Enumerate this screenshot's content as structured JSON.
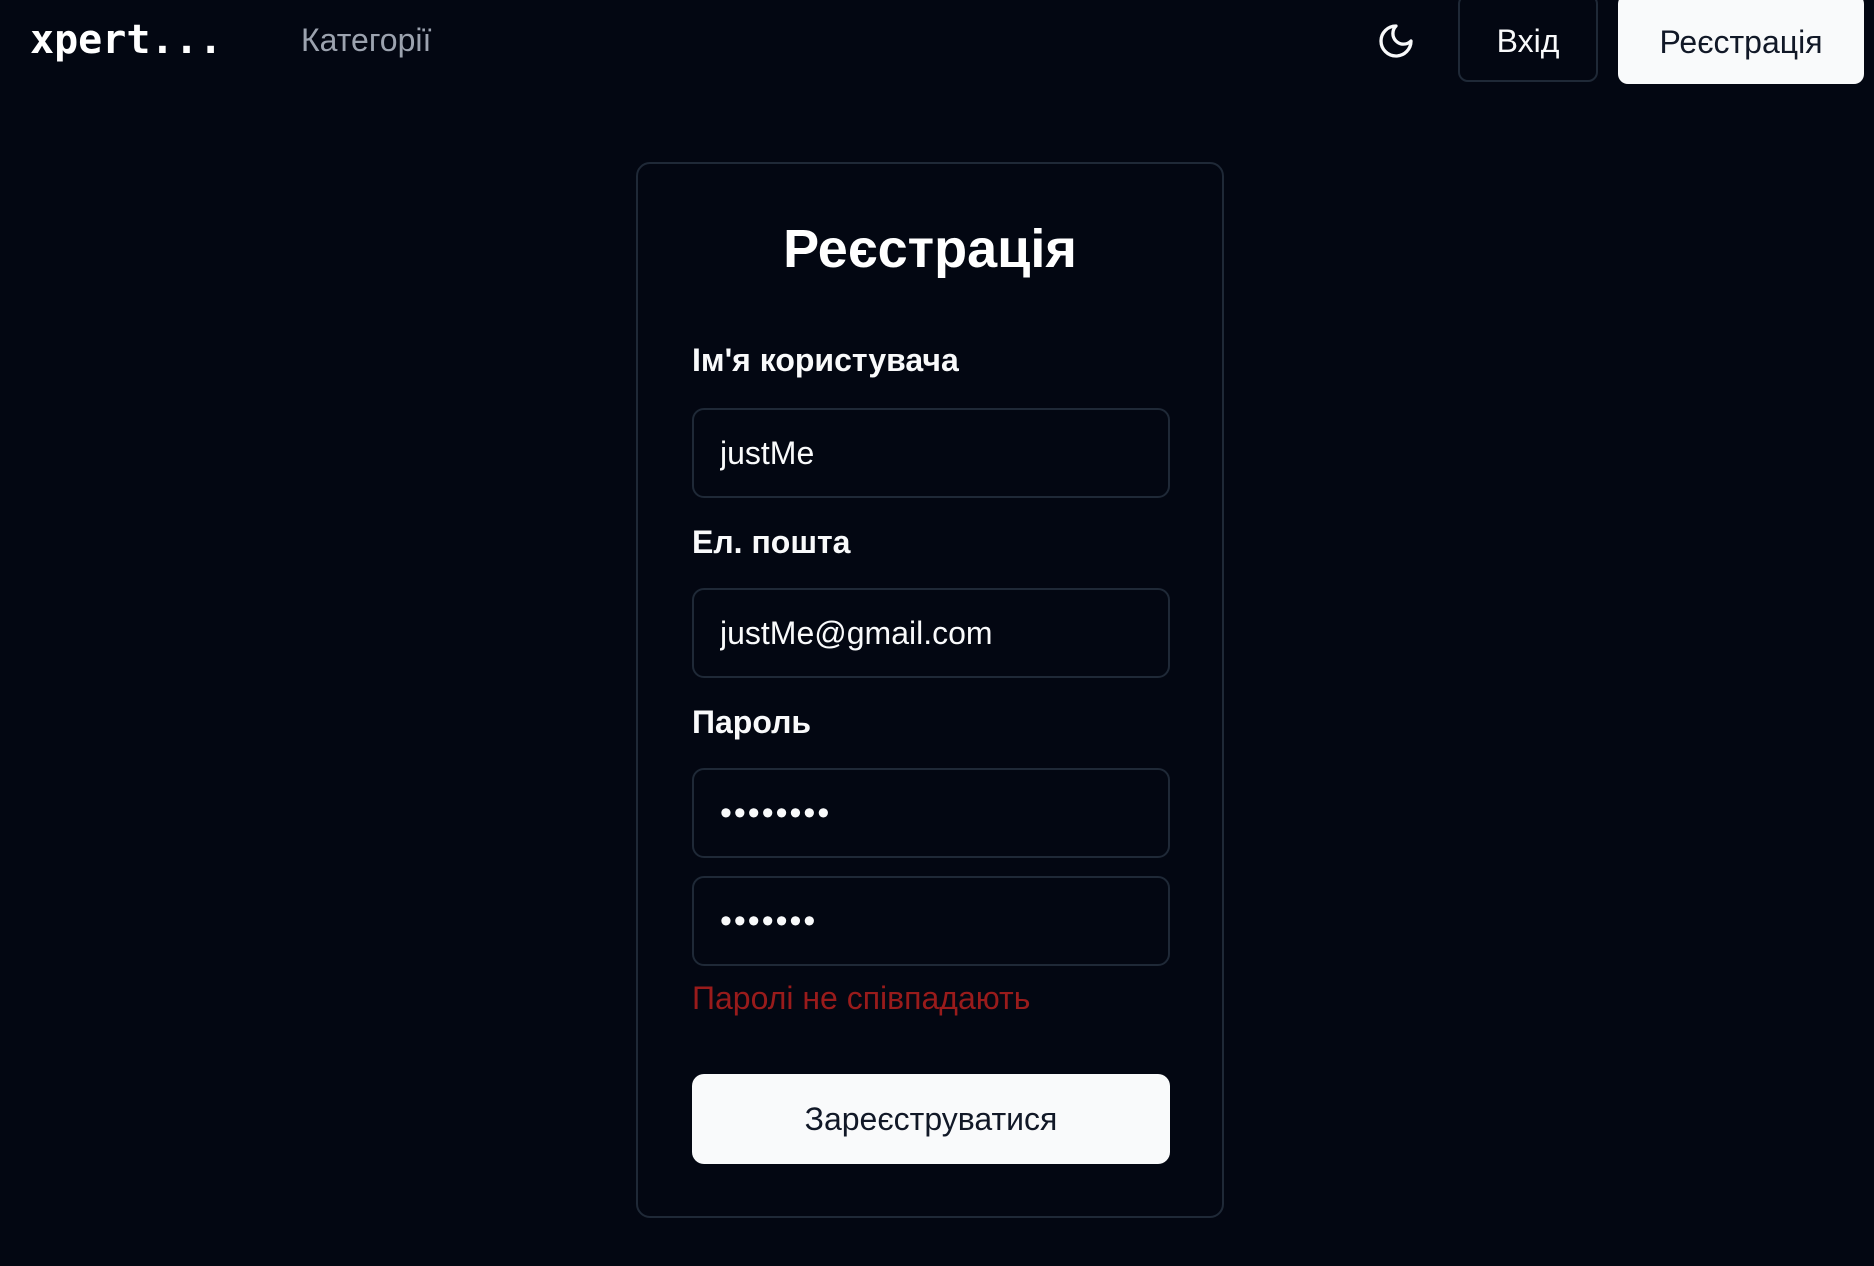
{
  "header": {
    "logo": "xpert...",
    "nav_link": "Категорії",
    "theme_toggle_icon": "moon-icon",
    "login_label": "Вхід",
    "register_label": "Реєстрація"
  },
  "form": {
    "title": "Реєстрація",
    "username_label": "Ім'я користувача",
    "username_value": "justMe",
    "email_label": "Ел. пошта",
    "email_value": "justMe@gmail.com",
    "password_label": "Пароль",
    "password_value": "12345678",
    "password_confirm_value": "1234567",
    "error_message": "Паролі не співпадають",
    "submit_label": "Зареєструватися"
  },
  "colors": {
    "background": "#030712",
    "border": "#1f2937",
    "error": "#991b1b",
    "button_bg": "#f9fafb"
  }
}
